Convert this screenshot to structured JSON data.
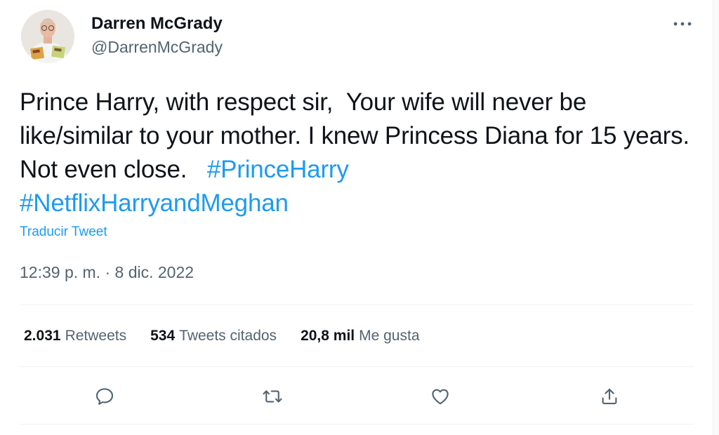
{
  "tweet": {
    "author": {
      "name": "Darren McGrady",
      "handle": "@DarrenMcGrady"
    },
    "text": {
      "line1": "Prince Harry, with respect sir,  Your wife will never be like/similar to your mother. I knew Princess Diana for 15 years. Not even close.   ",
      "hashtag1": "#PrinceHarry",
      "hashtag2": "#NetflixHarryandMeghan"
    },
    "translate_label": "Traducir Tweet",
    "time": "12:39 p. m.",
    "separator": " · ",
    "date": "8 dic. 2022",
    "stats": [
      {
        "count": "2.031",
        "label": "Retweets"
      },
      {
        "count": "534",
        "label": "Tweets citados"
      },
      {
        "count": "20,8 mil",
        "label": "Me gusta"
      }
    ],
    "actions": [
      {
        "icon": "reply-icon"
      },
      {
        "icon": "retweet-icon"
      },
      {
        "icon": "like-icon"
      },
      {
        "icon": "share-icon"
      }
    ]
  },
  "colors": {
    "link": "#1d9bf0",
    "text": "#0f1419",
    "secondary": "#536471",
    "divider": "#eff3f4"
  }
}
